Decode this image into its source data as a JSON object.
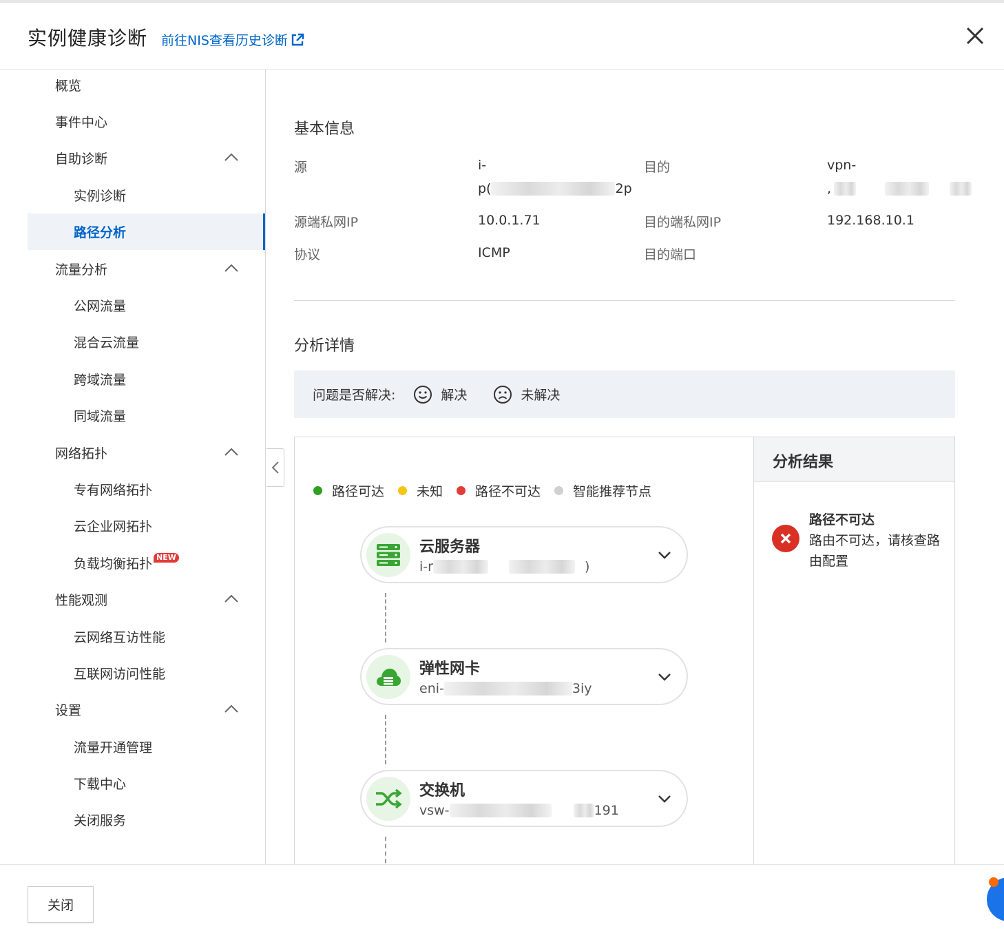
{
  "header": {
    "title": "实例健康诊断",
    "history_link": "前往NIS查看历史诊断"
  },
  "sidebar": {
    "items": [
      {
        "label": "概览",
        "level": 1
      },
      {
        "label": "事件中心",
        "level": 1
      },
      {
        "label": "自助诊断",
        "level": 1,
        "expanded": true
      },
      {
        "label": "实例诊断",
        "level": 2
      },
      {
        "label": "路径分析",
        "level": 2,
        "active": true
      },
      {
        "label": "流量分析",
        "level": 1,
        "expanded": true
      },
      {
        "label": "公网流量",
        "level": 2
      },
      {
        "label": "混合云流量",
        "level": 2
      },
      {
        "label": "跨域流量",
        "level": 2
      },
      {
        "label": "同域流量",
        "level": 2
      },
      {
        "label": "网络拓扑",
        "level": 1,
        "expanded": true
      },
      {
        "label": "专有网络拓扑",
        "level": 2
      },
      {
        "label": "云企业网拓扑",
        "level": 2
      },
      {
        "label": "负载均衡拓扑",
        "level": 2,
        "badge": "NEW"
      },
      {
        "label": "性能观测",
        "level": 1,
        "expanded": true
      },
      {
        "label": "云网络互访性能",
        "level": 2
      },
      {
        "label": "互联网访问性能",
        "level": 2
      },
      {
        "label": "设置",
        "level": 1,
        "expanded": true
      },
      {
        "label": "流量开通管理",
        "level": 2
      },
      {
        "label": "下载中心",
        "level": 2
      },
      {
        "label": "关闭服务",
        "level": 2
      }
    ]
  },
  "basic_info": {
    "title": "基本信息",
    "source_label": "源",
    "source_value_line1": "i-",
    "source_value_prefix": "p(",
    "source_value_suffix": "2p",
    "dest_label": "目的",
    "dest_value_line1": "vpn-",
    "dest_value_prefix": ",",
    "source_ip_label": "源端私网IP",
    "source_ip": "10.0.1.71",
    "dest_ip_label": "目的端私网IP",
    "dest_ip": "192.168.10.1",
    "protocol_label": "协议",
    "protocol": "ICMP",
    "dest_port_label": "目的端口",
    "dest_port": ""
  },
  "analysis": {
    "title": "分析详情",
    "question": "问题是否解决:",
    "resolved": "解决",
    "unresolved": "未解决",
    "legend": [
      {
        "label": "路径可达",
        "color": "#2ea121"
      },
      {
        "label": "未知",
        "color": "#f5c518"
      },
      {
        "label": "路径不可达",
        "color": "#e23c39"
      },
      {
        "label": "智能推荐节点",
        "color": "#d0d0d0"
      }
    ],
    "nodes": [
      {
        "name": "云服务器",
        "id_prefix": "i-r",
        "id_suffix": ")",
        "icon": "server-icon"
      },
      {
        "name": "弹性网卡",
        "id_prefix": "eni-",
        "id_suffix": "3iy",
        "icon": "cloud-icon"
      },
      {
        "name": "交换机",
        "id_prefix": "vsw-",
        "id_suffix": "191",
        "icon": "switch-icon"
      }
    ]
  },
  "result": {
    "title": "分析结果",
    "status": "路径不可达",
    "message": "路由不可达，请核查路由配置",
    "status_color": "#d93026"
  },
  "footer": {
    "close_label": "关闭"
  }
}
